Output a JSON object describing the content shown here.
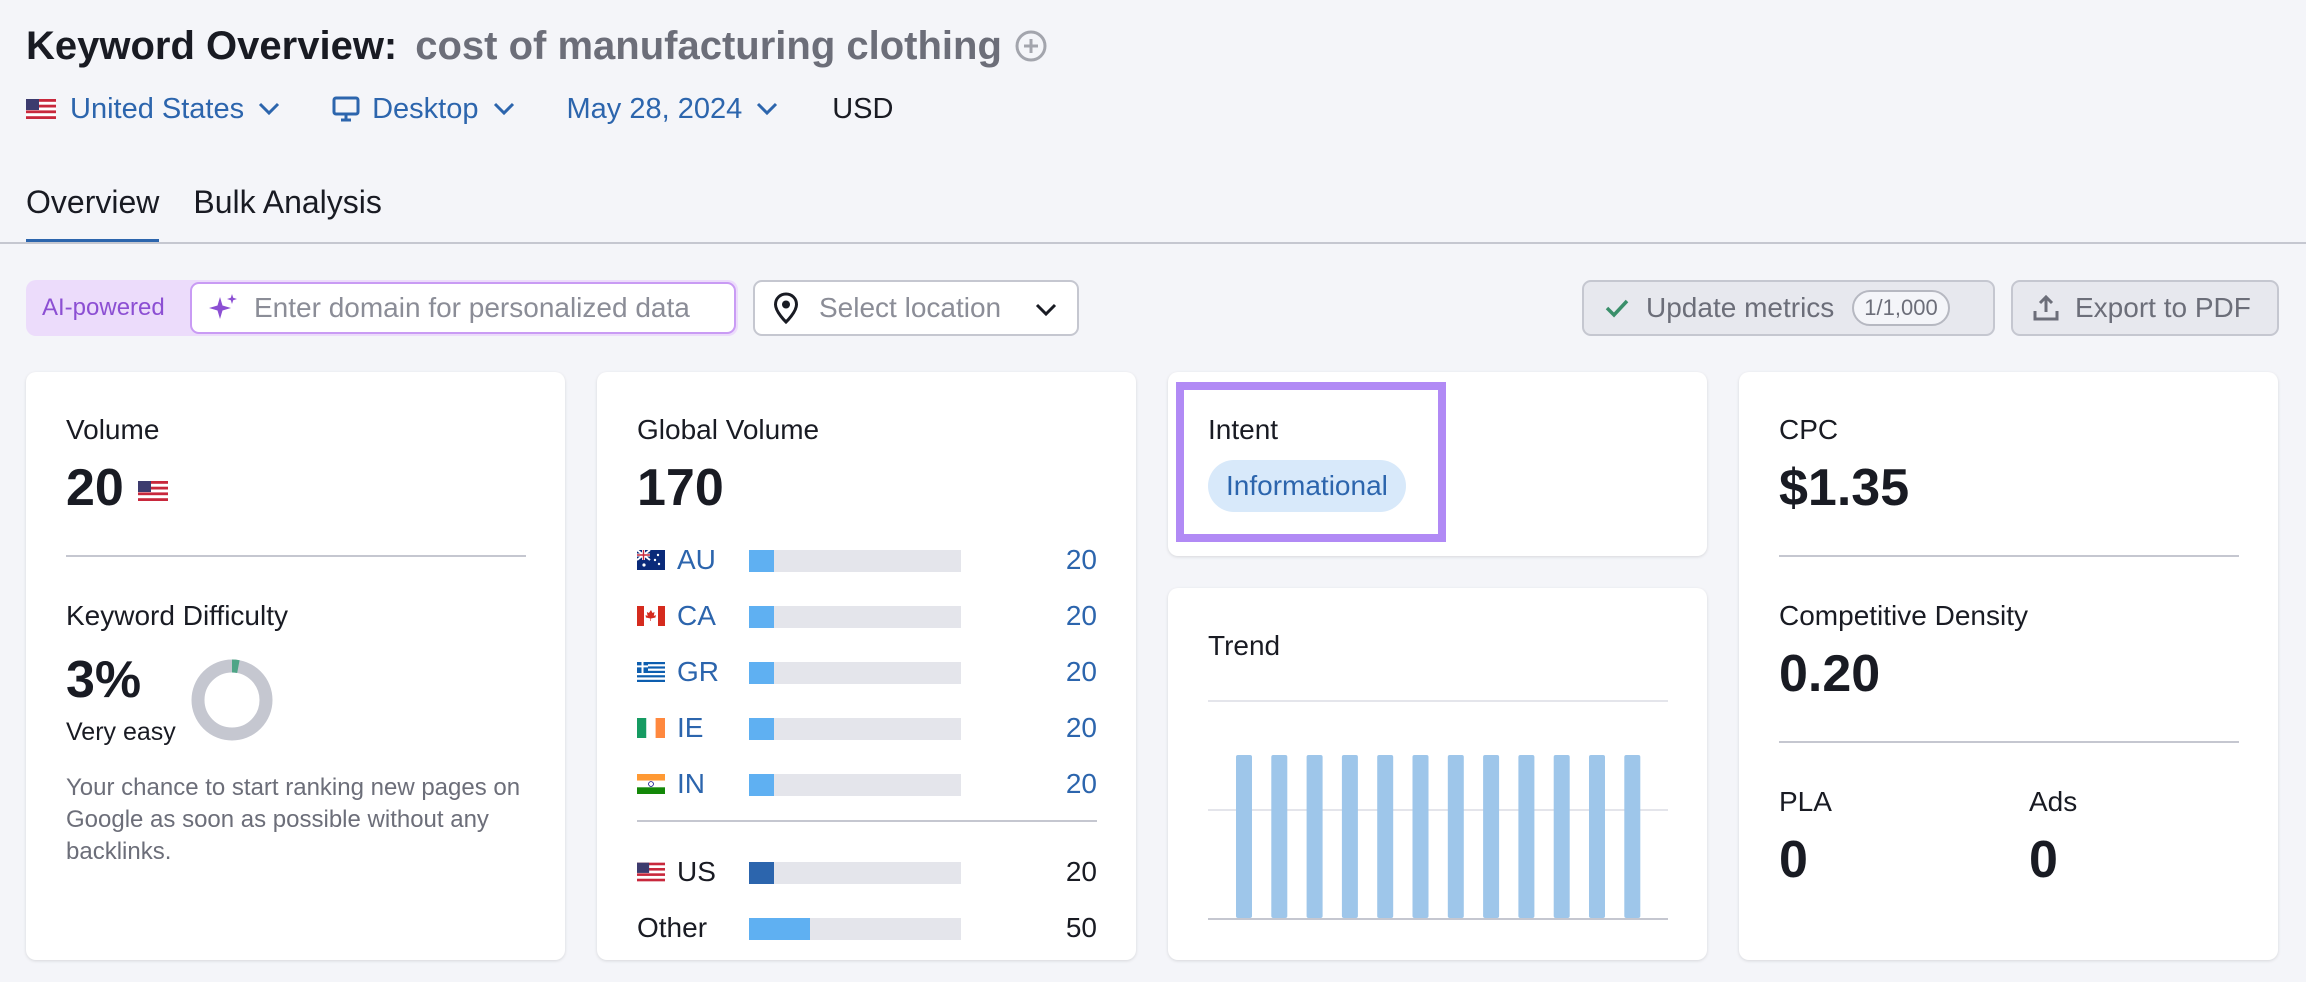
{
  "header": {
    "title": "Keyword Overview:",
    "keyword": "cost of manufacturing clothing",
    "filters": {
      "country": "United States",
      "device": "Desktop",
      "date": "May 28, 2024",
      "currency": "USD"
    }
  },
  "tabs": [
    {
      "label": "Overview",
      "active": true
    },
    {
      "label": "Bulk Analysis",
      "active": false
    }
  ],
  "toolbar": {
    "ai_label": "AI-powered",
    "domain_placeholder": "Enter domain for personalized data",
    "location_placeholder": "Select location",
    "update_label": "Update metrics",
    "update_count": "1/1,000",
    "export_label": "Export to PDF"
  },
  "volume": {
    "label": "Volume",
    "value": "20"
  },
  "keyword_difficulty": {
    "label": "Keyword Difficulty",
    "value": "3%",
    "rating": "Very easy",
    "percent": 3,
    "description": "Your chance to start ranking new pages on Google as soon as possible without any backlinks."
  },
  "global_volume": {
    "label": "Global Volume",
    "value": "170",
    "countries": [
      {
        "code": "AU",
        "value": "20",
        "share": 0.12
      },
      {
        "code": "CA",
        "value": "20",
        "share": 0.12
      },
      {
        "code": "GR",
        "value": "20",
        "share": 0.12
      },
      {
        "code": "IE",
        "value": "20",
        "share": 0.12
      },
      {
        "code": "IN",
        "value": "20",
        "share": 0.12
      }
    ],
    "us": {
      "code": "US",
      "value": "20",
      "share": 0.12
    },
    "other": {
      "code": "Other",
      "value": "50",
      "share": 0.29
    }
  },
  "intent": {
    "label": "Intent",
    "value": "Informational"
  },
  "trend": {
    "label": "Trend",
    "values": [
      1,
      1,
      1,
      1,
      1,
      1,
      1,
      1,
      1,
      1,
      1,
      1
    ]
  },
  "cpc": {
    "label": "CPC",
    "value": "$1.35"
  },
  "competitive_density": {
    "label": "Competitive Density",
    "value": "0.20"
  },
  "pla": {
    "label": "PLA",
    "value": "0"
  },
  "ads": {
    "label": "Ads",
    "value": "0"
  },
  "colors": {
    "link": "#2c65ad",
    "highlight": "#b18af5",
    "bar_light": "#5fb0f2",
    "trend_bar": "#9ec6ea"
  }
}
